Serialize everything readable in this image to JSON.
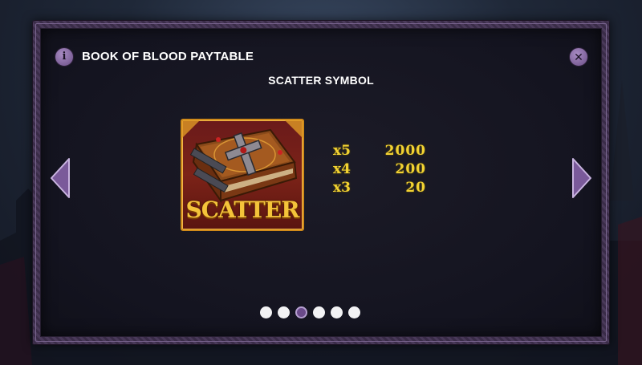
{
  "header": {
    "title": "BOOK OF BLOOD PAYTABLE",
    "info_icon": "info-icon",
    "info_glyph": "i",
    "close_icon": "close-icon",
    "close_glyph": "✕"
  },
  "page": {
    "subtitle": "SCATTER SYMBOL"
  },
  "symbol": {
    "name": "Scatter book",
    "label": "SCATTER",
    "icon": "book-cross-icon",
    "frame_color": "#d08a1a",
    "label_color": "#f4c33a"
  },
  "paytable": {
    "text_color": "#f2d232",
    "rows": [
      {
        "multiplier": "x5",
        "payout": "2000"
      },
      {
        "multiplier": "x4",
        "payout": "200"
      },
      {
        "multiplier": "x3",
        "payout": "20"
      }
    ]
  },
  "navigation": {
    "prev_icon": "chevron-left-icon",
    "next_icon": "chevron-right-icon",
    "arrow_color": "#b59fd0"
  },
  "pager": {
    "total_pages": 6,
    "current_page": 3,
    "active_color": "#6a4a8a"
  }
}
